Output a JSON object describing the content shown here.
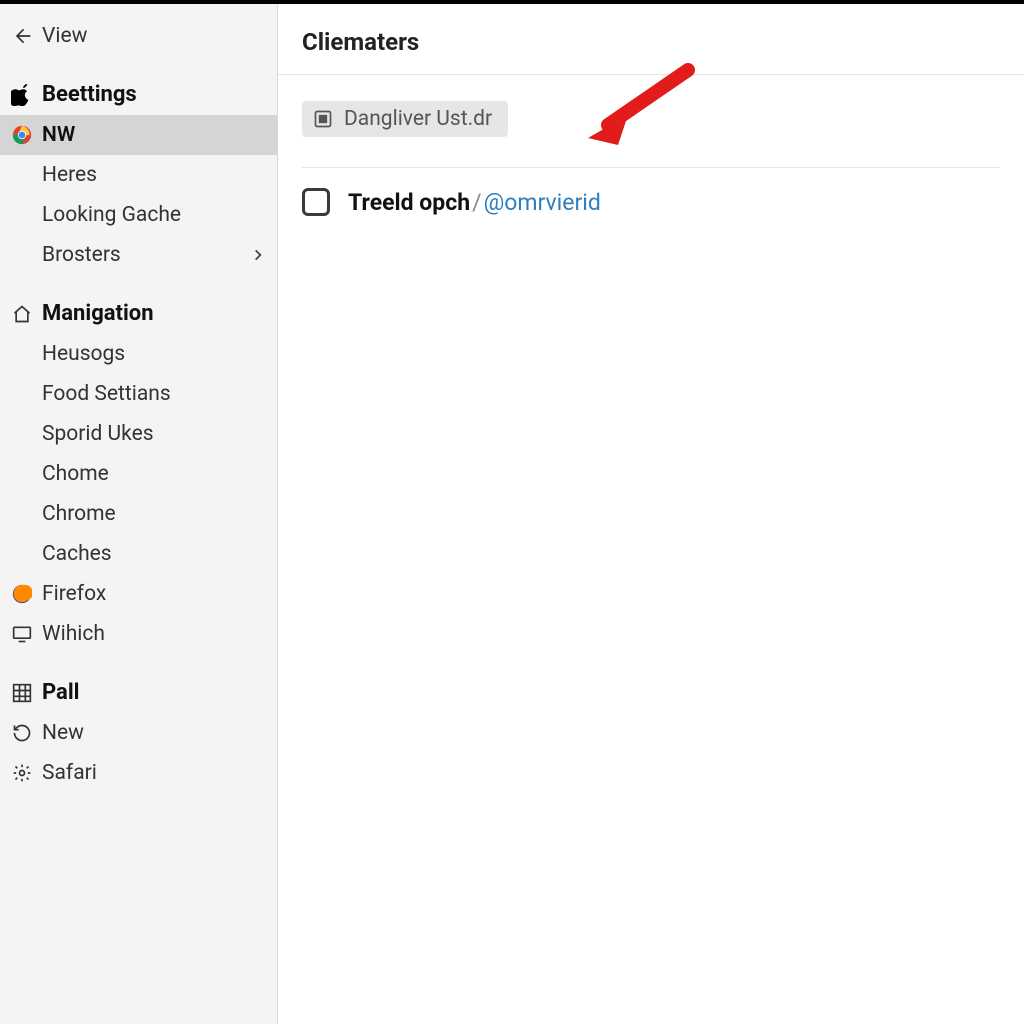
{
  "sidebar": {
    "view": {
      "label": "View"
    },
    "sections": [
      {
        "id": "beettings",
        "label": "Beettings",
        "icon": "apple",
        "items": [
          {
            "id": "nw",
            "label": "NW",
            "icon": "chrome",
            "active": true
          },
          {
            "id": "heres",
            "label": "Heres"
          },
          {
            "id": "looking-gache",
            "label": "Looking Gache"
          },
          {
            "id": "brosters",
            "label": "Brosters",
            "chevron": true
          }
        ]
      },
      {
        "id": "manigation",
        "label": "Manigation",
        "icon": "house",
        "items": [
          {
            "id": "heusogs",
            "label": "Heusogs"
          },
          {
            "id": "food-settians",
            "label": "Food Settians"
          },
          {
            "id": "sporid-ukes",
            "label": "Sporid Ukes"
          },
          {
            "id": "chome",
            "label": "Chome"
          },
          {
            "id": "chrome2",
            "label": "Chrome"
          },
          {
            "id": "caches",
            "label": "Caches"
          },
          {
            "id": "firefox",
            "label": "Firefox",
            "icon": "firefox"
          },
          {
            "id": "wihich",
            "label": "Wihich",
            "icon": "monitor"
          }
        ]
      },
      {
        "id": "pall",
        "label": "Pall",
        "icon": "grid",
        "items": [
          {
            "id": "new",
            "label": "New",
            "icon": "refresh"
          },
          {
            "id": "safari",
            "label": "Safari",
            "icon": "gear"
          }
        ]
      }
    ]
  },
  "main": {
    "title": "Cliematers",
    "file": {
      "name": "Dangliver Ust.dr"
    },
    "item": {
      "label": "Treeld opch",
      "slash": "/",
      "handle": "@omrvierid",
      "checked": false
    }
  }
}
